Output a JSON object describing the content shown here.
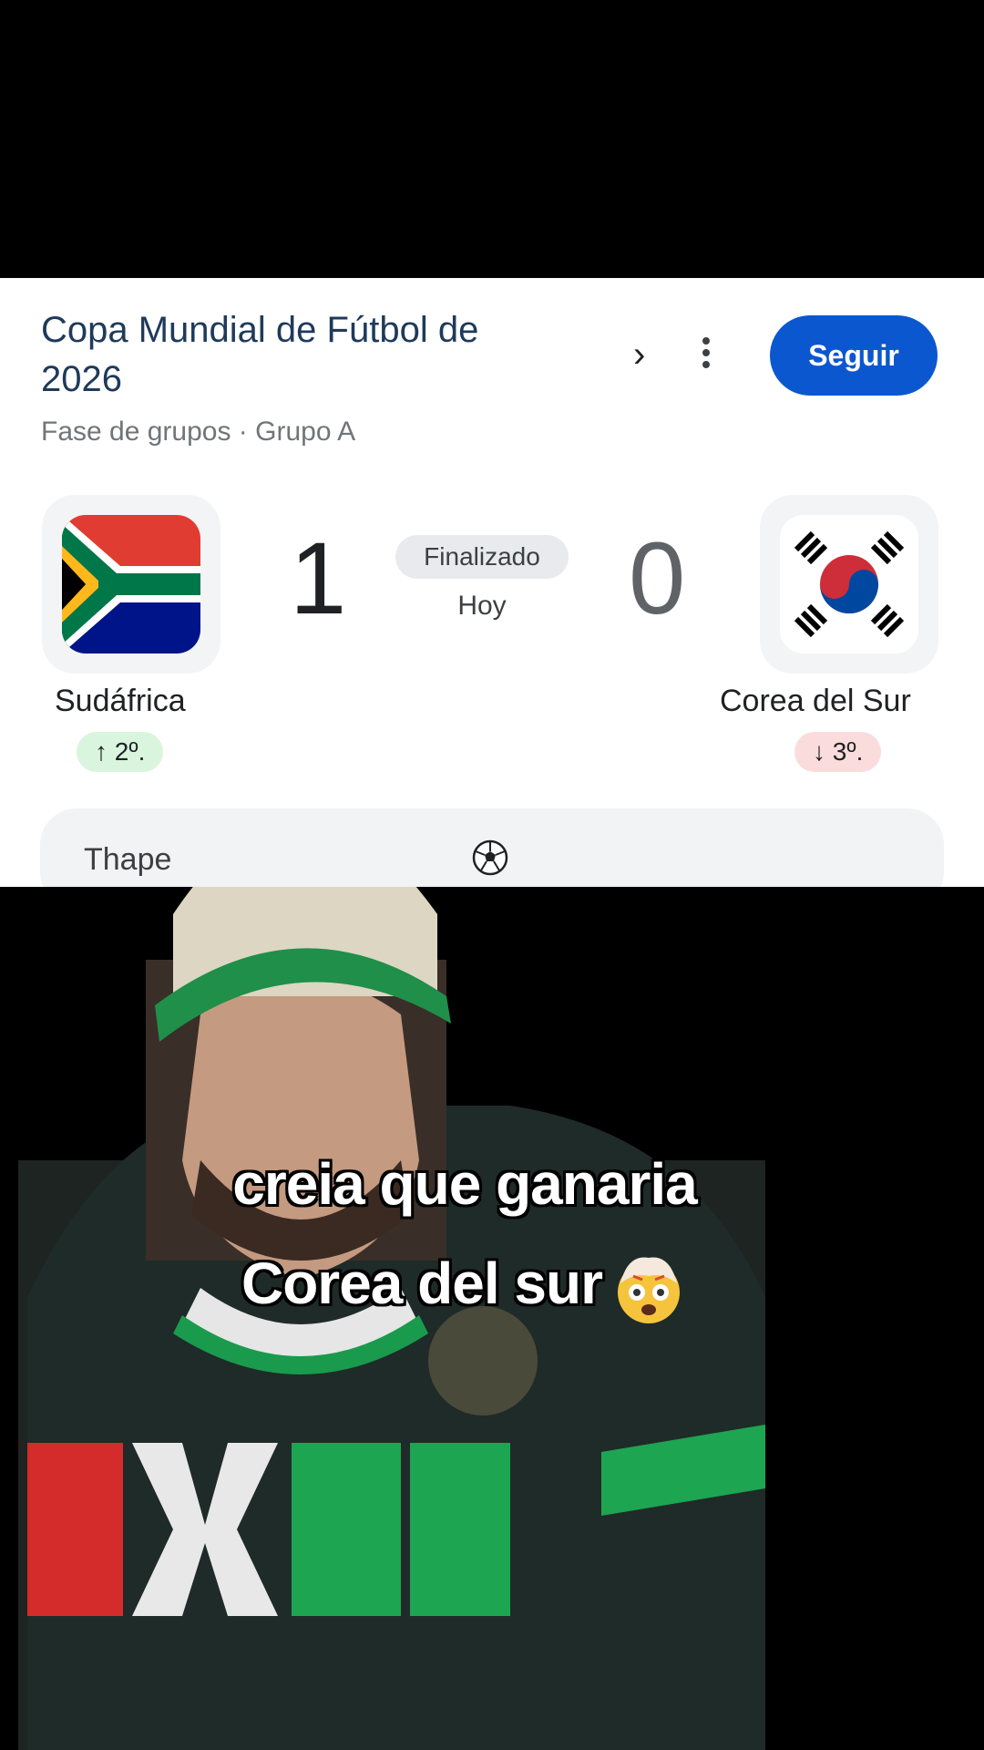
{
  "card": {
    "title": "Copa Mundial de Fútbol de 2026",
    "subtitle": "Fase de grupos · Grupo A",
    "chevron_icon": "chevron-right-icon",
    "menu_icon": "more-vert-icon",
    "follow_label": "Seguir",
    "accent_color": "#0b57d0"
  },
  "match": {
    "home": {
      "name": "Sudáfrica",
      "score": "1",
      "position": "↑ 2º.",
      "flag_icon": "south-africa-flag-icon",
      "badge_color": "#d9f5dd"
    },
    "away": {
      "name": "Corea del Sur",
      "score": "0",
      "position": "↓ 3º.",
      "flag_icon": "south-korea-flag-icon",
      "badge_color": "#fbdcdc"
    },
    "status": "Finalizado",
    "time": "Hoy"
  },
  "next": {
    "text": "Thape",
    "icon": "soccer-ball-icon"
  },
  "caption": {
    "line1": "creia que ganaria",
    "line2": "Corea del sur",
    "emoji": "exploding-head-emoji"
  }
}
